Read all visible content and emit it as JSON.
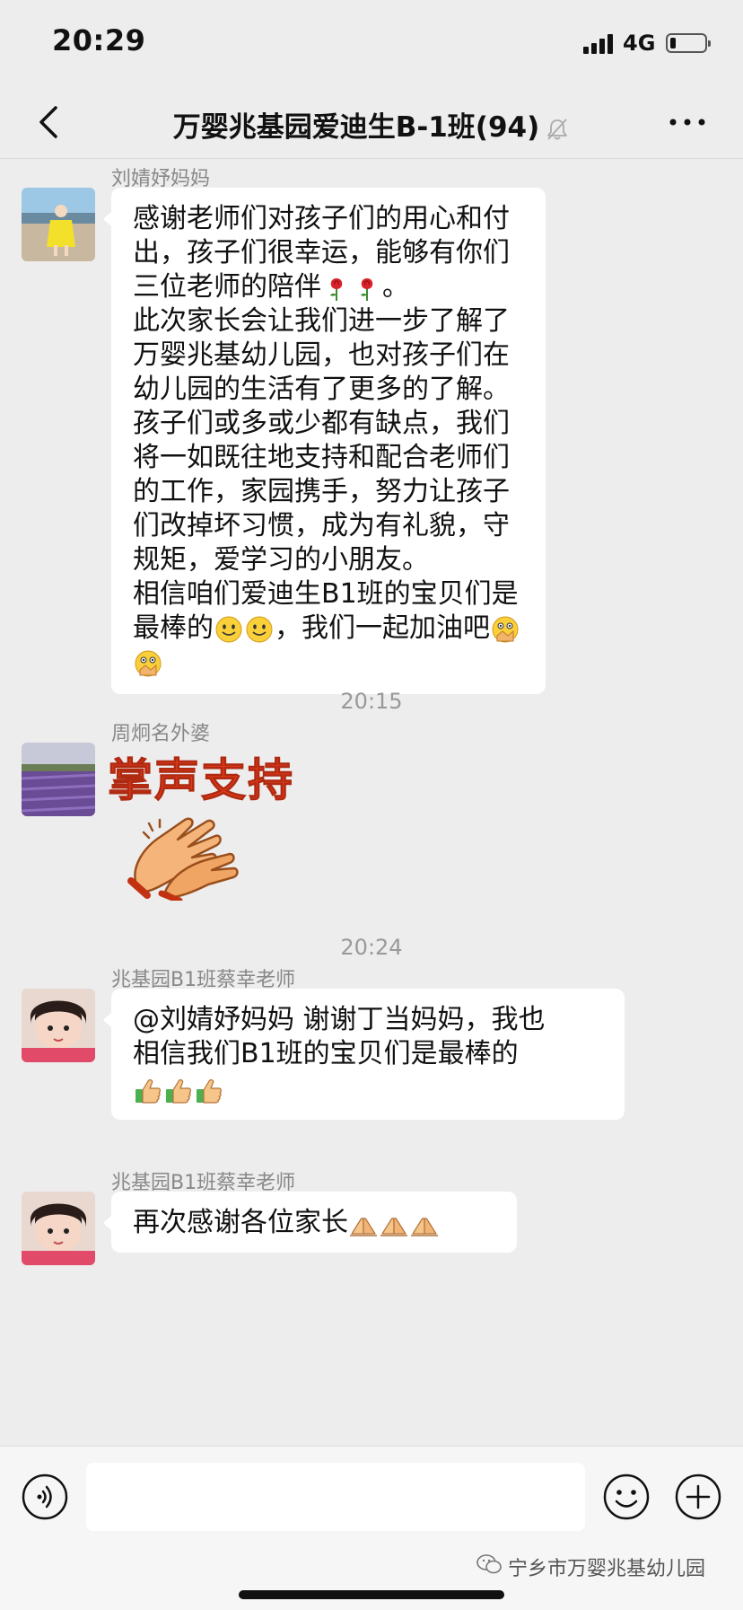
{
  "status_bar": {
    "time": "20:29",
    "network": "4G",
    "battery_level": 0.18
  },
  "nav": {
    "title": "万婴兆基园爱迪生B-1班(94)",
    "muted": true
  },
  "messages": [
    {
      "sender": "刘婧妤妈妈",
      "paragraphs": [
        "感谢老师们对孩子们的用心和付出，孩子们很幸运，能够有你们三位老师的陪伴",
        "此次家长会让我们进一步了解了万婴兆基幼儿园，也对孩子们在幼儿园的生活有了更多的了解。孩子们或多或少都有缺点，我们将一如既往地支持和配合老师们的工作，家园携手，努力让孩子们改掉坏习惯，成为有礼貌，守规矩，爱学习的小朋友。",
        "相信咱们爱迪生B1班的宝贝们是最棒的",
        "，我们一起加油吧"
      ],
      "emoji_rose": "rose-emoji",
      "emoji_smile": "smile-emoji",
      "emoji_clap": "clap-emoji",
      "period_after_roses": "。"
    },
    {
      "time_divider": "20:15"
    },
    {
      "sender": "周炯名外婆",
      "sticker_text": "掌声支持",
      "sticker_icon": "clapping-hands-sticker"
    },
    {
      "time_divider": "20:24"
    },
    {
      "sender": "兆基园B1班蔡幸老师",
      "text_line1": "@刘婧妤妈妈 谢谢丁当妈妈，我也",
      "text_line2": "相信我们B1班的宝贝们是最棒的",
      "emoji_thumbs": "thumbs-up-emoji"
    },
    {
      "sender": "兆基园B1班蔡幸老师",
      "text": "再次感谢各位家长",
      "emoji_pray": "pray-emoji"
    }
  ],
  "input_bar": {
    "placeholder": "",
    "watermark": "宁乡市万婴兆基幼儿园"
  },
  "colors": {
    "background": "#ededed",
    "bubble": "#ffffff",
    "sticker_red": "#e23b1c"
  }
}
